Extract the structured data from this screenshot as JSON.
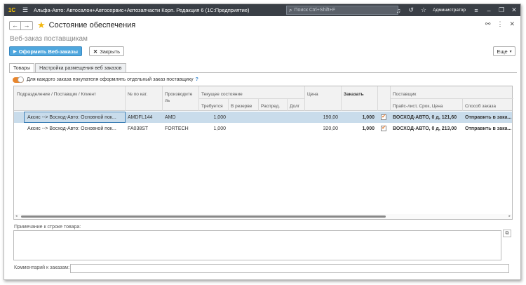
{
  "titlebar": {
    "logo": "1С",
    "app_title": "Альфа-Авто: Автосалон+Автосервис+Автозапчасти Корп. Редакция 6  (1С:Предприятие)",
    "search_placeholder": "Поиск Ctrl+Shift+F",
    "user": "Администратор"
  },
  "header": {
    "back_icon": "←",
    "forward_icon": "→",
    "title": "Состояние обеспечения"
  },
  "subtitle": "Веб-заказ поставщикам",
  "toolbar": {
    "submit_label": "Оформить Веб-заказы",
    "close_label": "Закрыть",
    "more_label": "Еще"
  },
  "tabs": [
    {
      "label": "Товары",
      "active": true
    },
    {
      "label": "Настройка размещения веб заказов",
      "active": false
    }
  ],
  "option": {
    "label": "Для каждого заказа покупателя оформлять отдельный заказ поставщику",
    "help": "?",
    "enabled": true
  },
  "grid": {
    "headers": {
      "department": "Подразделение / Поставщик / Клиент",
      "catalog_no": "№ по кат.",
      "manufacturer_line1": "Производите",
      "manufacturer_line2": "ль",
      "current_state": "Текущее состояние",
      "required": "Требуется",
      "reserved": "В резерве",
      "distributed": "Распред.",
      "debt": "Долг",
      "price": "Цена",
      "order": "Заказать",
      "supplier": "Поставщик",
      "price_list": "Прайс-лист, Срок, Цена",
      "order_method": "Способ заказа"
    },
    "rows": [
      {
        "department": "Аксис  --> Восход-Авто: Основной пок...",
        "catalog_no": "AMDFL144",
        "manufacturer": "AMD",
        "required": "1,000",
        "price": "190,00",
        "order": "1,000",
        "checked": true,
        "price_list": "ВОСХОД-АВТО, 0 д, 121,60",
        "order_method": "Отправить в зака...",
        "selected": true
      },
      {
        "department": "Аксис  --> Восход-Авто: Основной пок...",
        "catalog_no": "FA038ST",
        "manufacturer": "FORTECH",
        "required": "1,000",
        "price": "320,00",
        "order": "1,000",
        "checked": true,
        "price_list": "ВОСХОД-АВТО, 0 д, 213,00",
        "order_method": "Отправить в зака...",
        "selected": false
      }
    ]
  },
  "note_label": "Примечание к строке товара:",
  "comment_label": "Комментарий к заказам:"
}
